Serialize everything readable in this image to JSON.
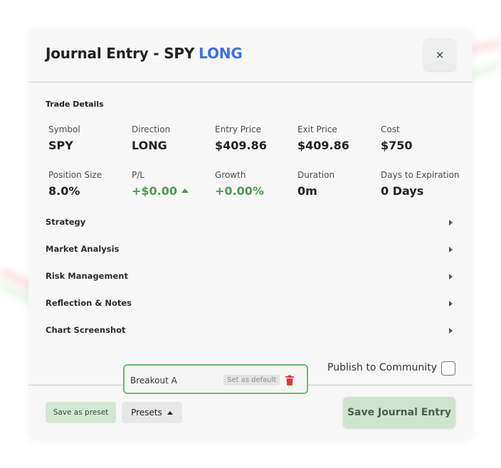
{
  "modal": {
    "title": "Journal Entry - SPY",
    "direction": "LONG",
    "close_icon": "×"
  },
  "trade_details": {
    "title": "Trade Details",
    "stats": [
      {
        "label": "Symbol",
        "value": "SPY"
      },
      {
        "label": "Direction",
        "value": "LONG"
      },
      {
        "label": "Entry Price",
        "value": "$409.86"
      },
      {
        "label": "Exit Price",
        "value": "$409.86"
      },
      {
        "label": "Cost",
        "value": "$750"
      },
      {
        "label": "Position Size",
        "value": "8.0%"
      },
      {
        "label": "P/L",
        "value": "+$0.00"
      },
      {
        "label": "Growth",
        "value": "+0.00%"
      },
      {
        "label": "Duration",
        "value": "0m"
      },
      {
        "label": "Days to Expiration",
        "value": "0 Days"
      }
    ]
  },
  "sections": [
    "Strategy",
    "Market Analysis",
    "Risk Management",
    "Reflection & Notes",
    "Chart Screenshot"
  ],
  "publish": {
    "label": "Publish to Community",
    "checked": false
  },
  "preset_popup": {
    "name": "Breakout A",
    "default_label": "Set as default"
  },
  "footer": {
    "save_preset": "Save as preset",
    "presets": "Presets",
    "save_entry": "Save Journal Entry"
  },
  "colors": {
    "accent_blue": "#3a6ff2",
    "positive_green": "#4f9a57",
    "delete_red": "#e53935"
  }
}
